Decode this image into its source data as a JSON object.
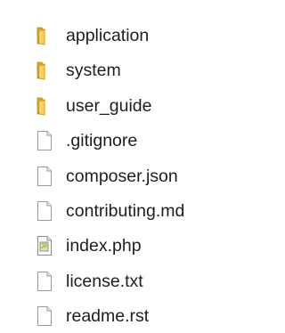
{
  "colors": {
    "folder_back": "#d9a520",
    "folder_front": "#f6cf5a",
    "folder_edge": "#b78717",
    "file_body": "#ffffff",
    "file_edge": "#9a9a9a",
    "text": "#1e1e1e"
  },
  "items": [
    {
      "label": "application",
      "icon": "folder-icon"
    },
    {
      "label": "system",
      "icon": "folder-icon"
    },
    {
      "label": "user_guide",
      "icon": "folder-icon"
    },
    {
      "label": ".gitignore",
      "icon": "file-icon"
    },
    {
      "label": "composer.json",
      "icon": "file-icon"
    },
    {
      "label": "contributing.md",
      "icon": "file-icon"
    },
    {
      "label": "index.php",
      "icon": "php-file-icon"
    },
    {
      "label": "license.txt",
      "icon": "file-icon"
    },
    {
      "label": "readme.rst",
      "icon": "file-icon"
    }
  ]
}
